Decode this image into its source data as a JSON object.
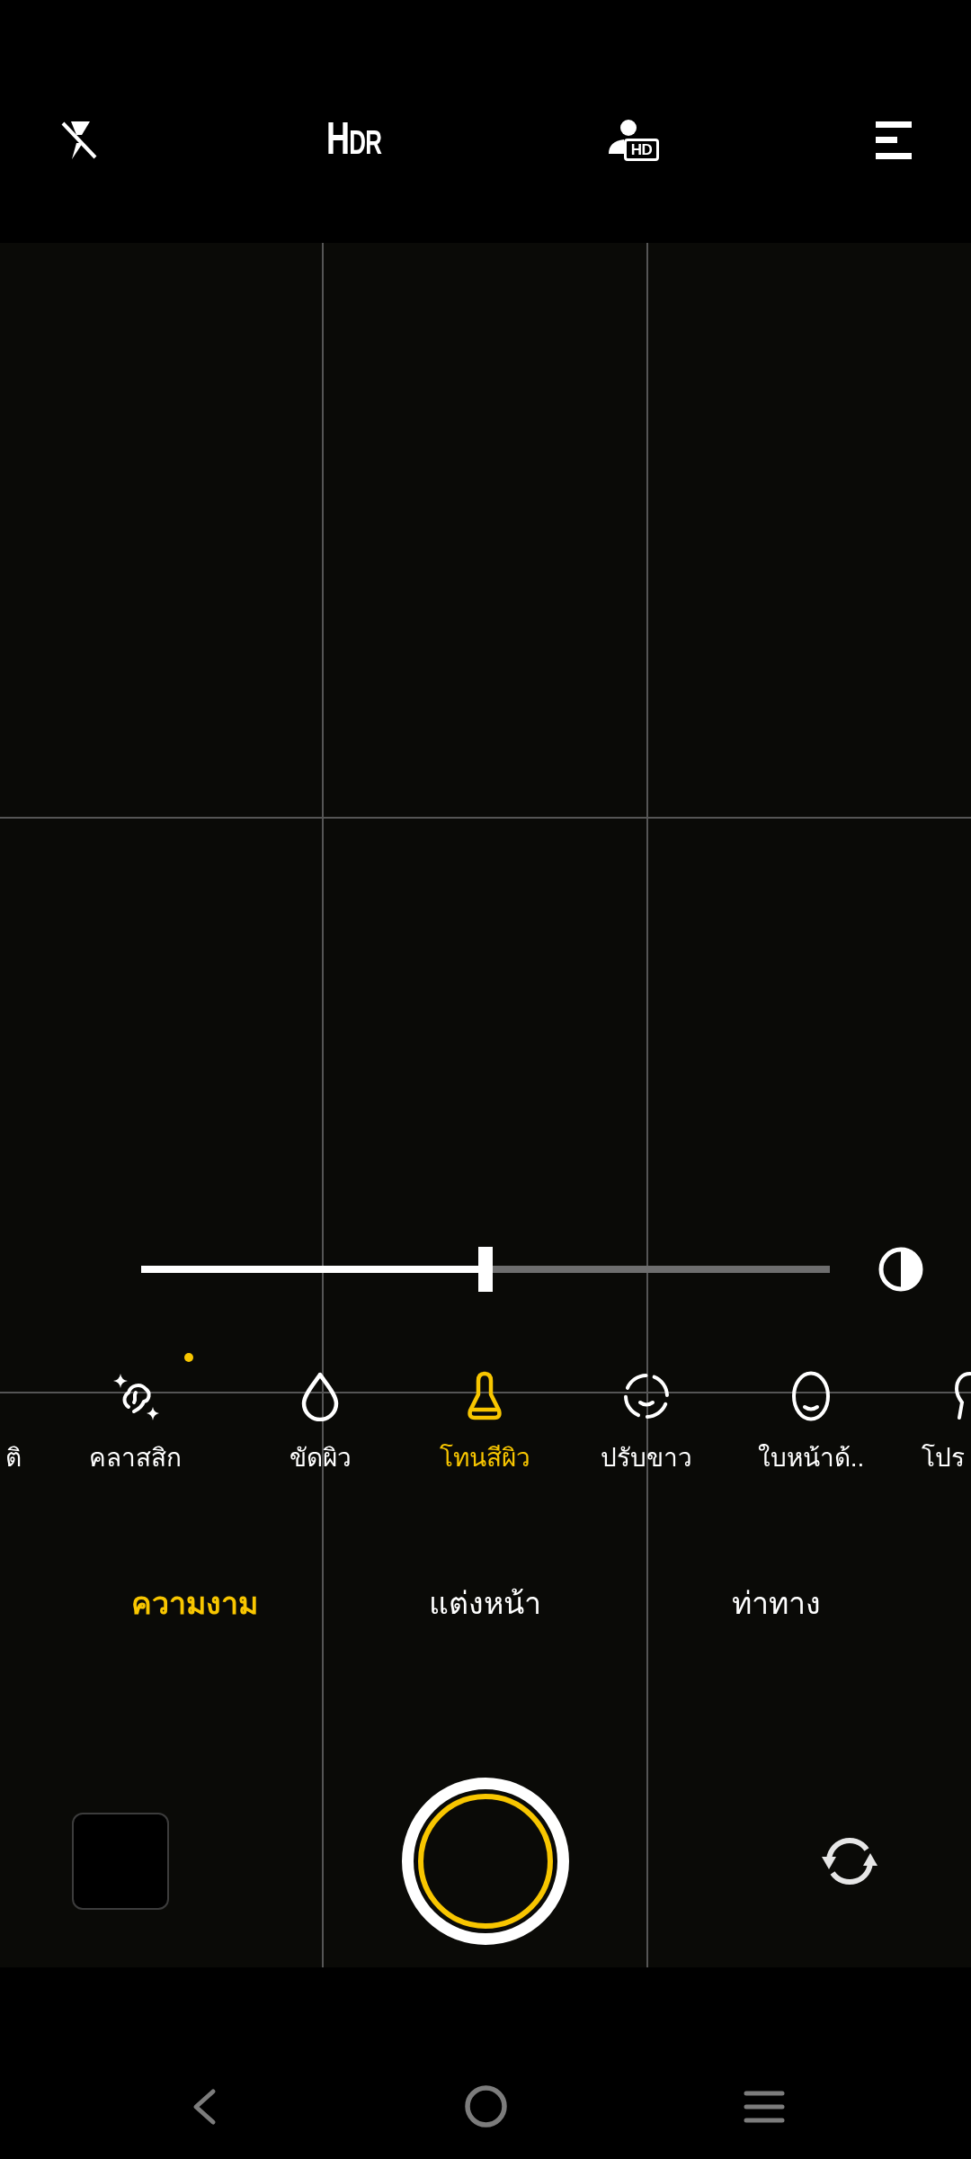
{
  "top_bar": {
    "flash_on": false,
    "hdr": "HDR",
    "hd_badge": "HD"
  },
  "slider": {
    "level": 0.5
  },
  "beauty_options": [
    {
      "label": "ติ",
      "selected": false,
      "dot": false
    },
    {
      "label": "คลาสสิก",
      "selected": false,
      "dot": true
    },
    {
      "label": "ขัดผิว",
      "selected": false,
      "dot": false
    },
    {
      "label": "โทนสีผิว",
      "selected": true,
      "dot": false
    },
    {
      "label": "ปรับขาว",
      "selected": false,
      "dot": false
    },
    {
      "label": "ใบหน้าด้..",
      "selected": false,
      "dot": false
    },
    {
      "label": "โปร",
      "selected": false,
      "dot": false
    }
  ],
  "mode_tabs": [
    {
      "label": "ความงาม",
      "selected": true
    },
    {
      "label": "แต่งหน้า",
      "selected": false
    },
    {
      "label": "ท่าทาง",
      "selected": false
    }
  ]
}
